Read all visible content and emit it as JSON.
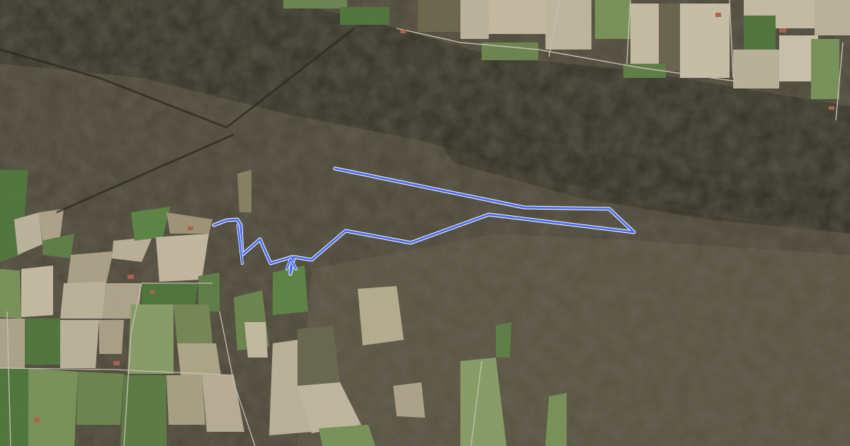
{
  "map": {
    "kind": "satellite",
    "colors": {
      "forest_dark": "#2f2c22",
      "forest_mid": "#4a4535",
      "forest_light": "#5e5644",
      "field_green": "#4f7a3c",
      "field_light_green": "#7c9a5c",
      "field_tan": "#c9bfa8",
      "field_beige": "#b8ad93",
      "road": "#d6d0c4",
      "track": "#4a6cf0",
      "track_halo": "#ffffff"
    }
  }
}
